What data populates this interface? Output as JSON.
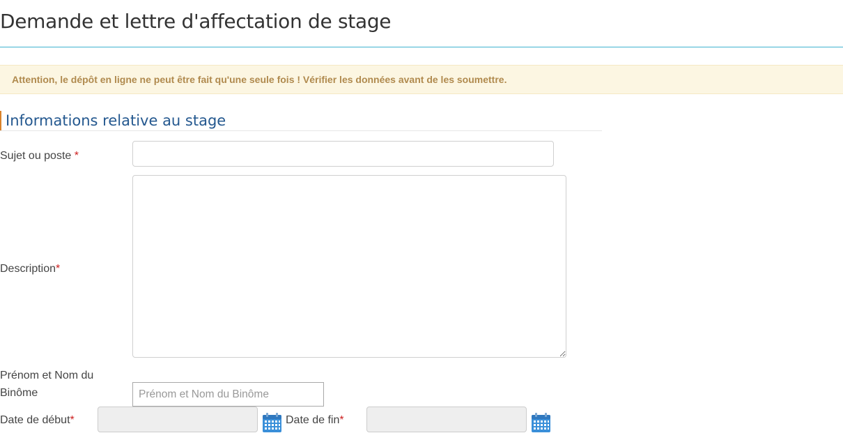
{
  "page": {
    "title": "Demande et lettre d'affectation de stage"
  },
  "alert": {
    "text": "Attention, le dépôt en ligne ne peut être fait qu'une seule fois ! Vérifier les données avant de les soumettre."
  },
  "section": {
    "title": "Informations relative au stage"
  },
  "form": {
    "required_mark": "*",
    "sujet": {
      "label": "Sujet ou poste ",
      "value": ""
    },
    "description": {
      "label": "Description",
      "value": ""
    },
    "binome": {
      "label": "Prénom et Nom du Binôme",
      "placeholder": "Prénom et Nom du Binôme",
      "value": ""
    },
    "date_debut": {
      "label": "Date de début",
      "value": ""
    },
    "date_fin": {
      "label": "Date de fin",
      "value": ""
    }
  },
  "icons": {
    "calendar": "calendar-icon",
    "calendar_color": "#3a8fd9"
  }
}
